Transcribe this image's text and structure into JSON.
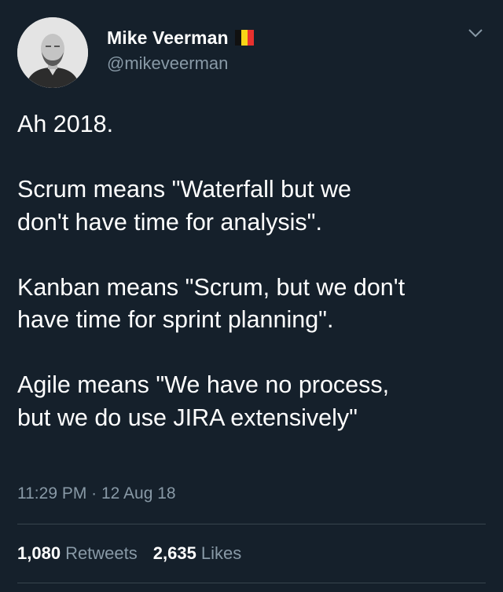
{
  "author": {
    "display_name": "Mike Veerman",
    "handle": "@mikeveerman",
    "flag_icon": "belgium-flag-icon",
    "flag_colors": [
      "#111111",
      "#f7d417",
      "#e8312e"
    ]
  },
  "menu": {
    "icon": "chevron-down-icon"
  },
  "tweet": {
    "paragraphs": [
      "Ah 2018.",
      "Scrum means \"Waterfall but we\ndon't have time for analysis\".",
      "Kanban means \"Scrum, but we don't\nhave time for sprint planning\".",
      "Agile means \"We have no process,\nbut we do use JIRA extensively\""
    ],
    "timestamp": "11:29 PM · 12 Aug 18"
  },
  "stats": {
    "retweets_count": "1,080",
    "retweets_label": "Retweets",
    "likes_count": "2,635",
    "likes_label": "Likes"
  },
  "colors": {
    "background": "#15202b",
    "text_primary": "#ffffff",
    "text_secondary": "#8899a6",
    "divider": "#38444d"
  }
}
